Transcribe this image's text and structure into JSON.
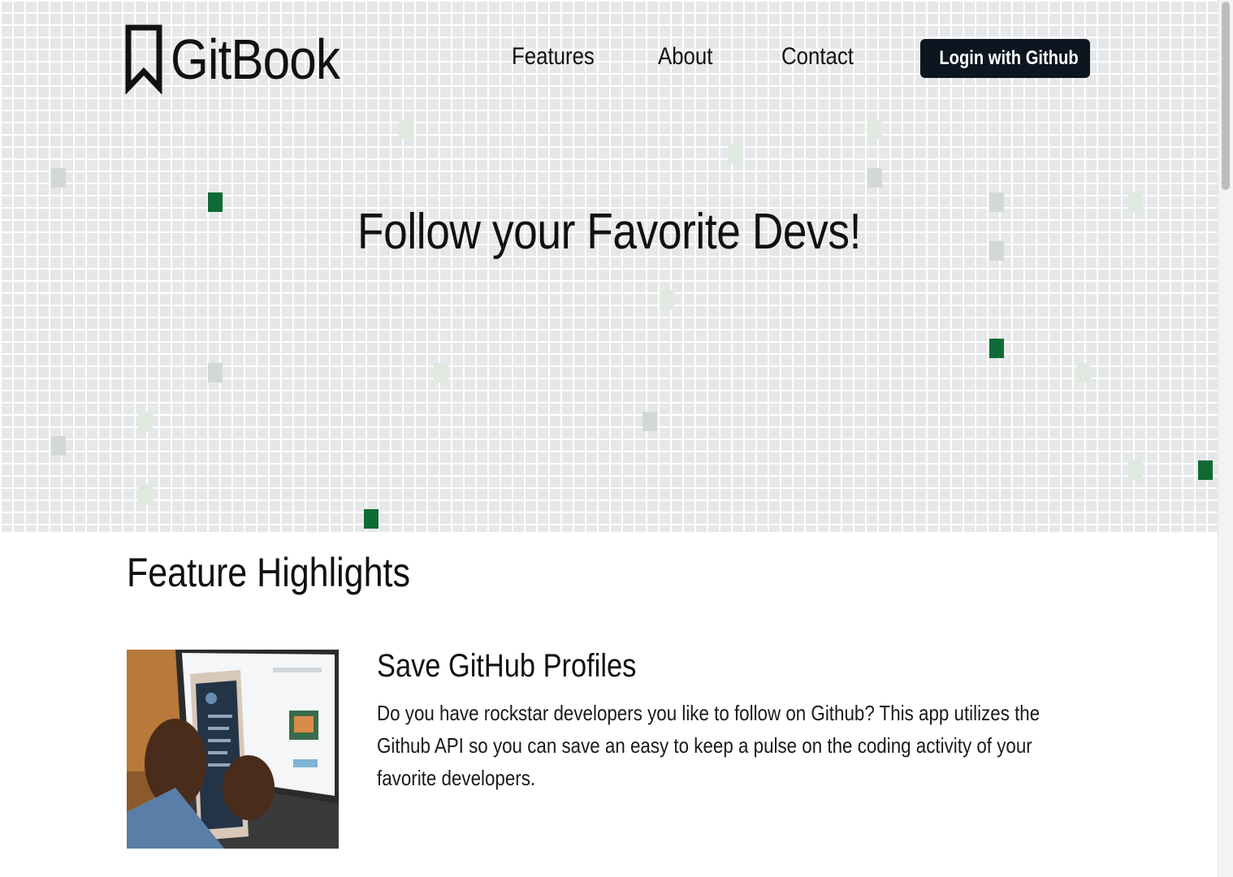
{
  "brand": {
    "name": "GitBook"
  },
  "nav": {
    "features": "Features",
    "about": "About",
    "contact": "Contact"
  },
  "login": {
    "label": "Login with Github"
  },
  "hero": {
    "title": "Follow your Favorite Devs!"
  },
  "features_section": {
    "title": "Feature Highlights",
    "items": [
      {
        "title": "Save GitHub Profiles",
        "description": "Do you have rockstar developers you like to follow on Github? This app utilizes the Github API so you can save an easy to keep a pulse on the coding activity of your favorite developers."
      }
    ]
  },
  "colors": {
    "accent": "#0f6b35",
    "grid_background": "#e6e7e9",
    "button_background": "#0b1620"
  }
}
